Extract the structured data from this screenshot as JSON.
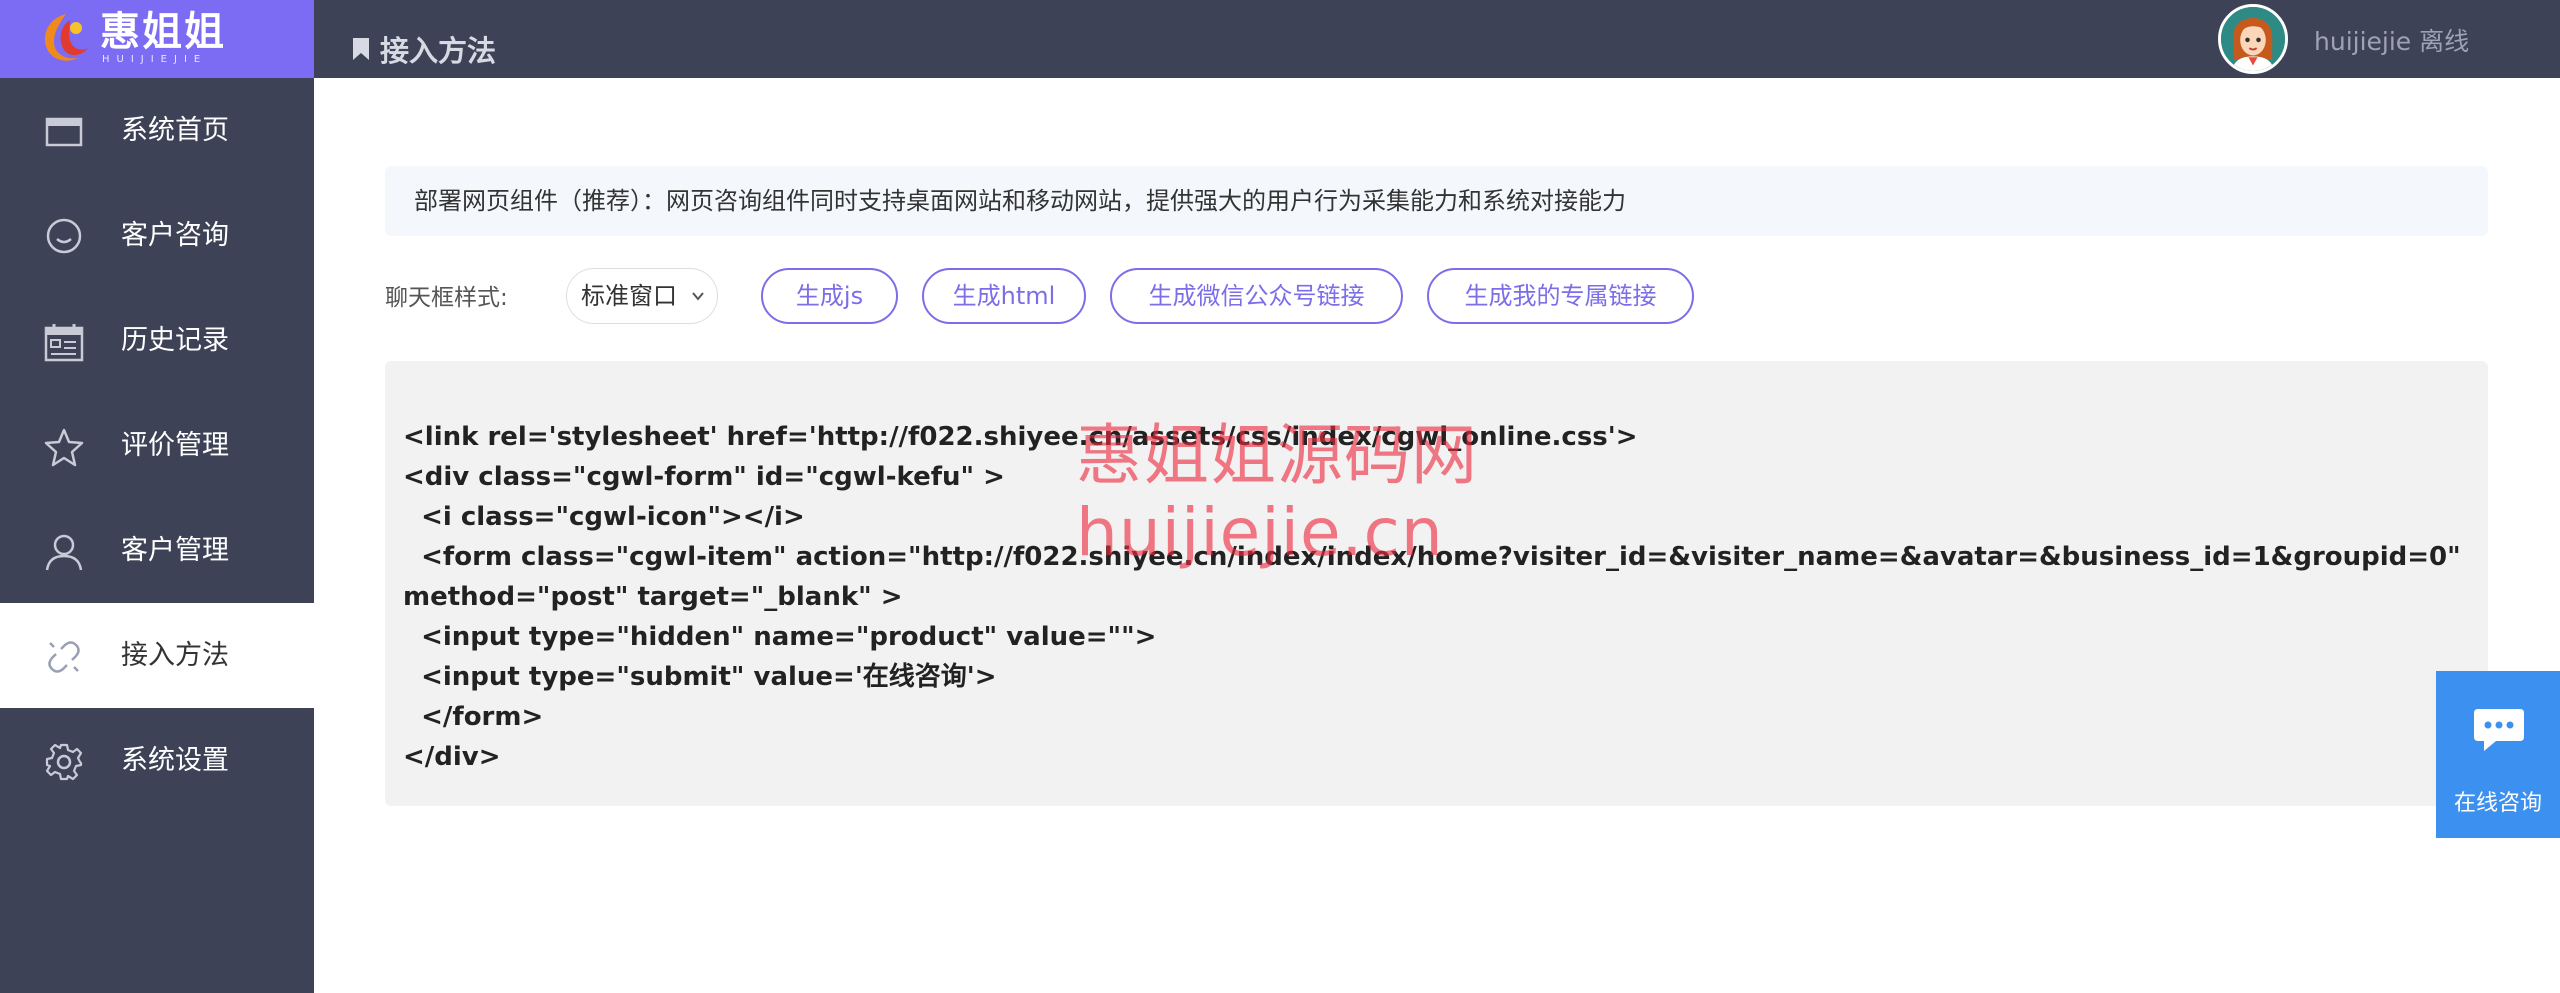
{
  "brand": {
    "name": "惠姐姐",
    "sub": "HUIJIEJIE"
  },
  "header": {
    "title": "接入方法",
    "user": "huijiejie 离线"
  },
  "sidebar": {
    "items": [
      {
        "label": "系统首页",
        "icon": "window-icon"
      },
      {
        "label": "客户咨询",
        "icon": "chat-bubble-icon"
      },
      {
        "label": "历史记录",
        "icon": "calendar-list-icon"
      },
      {
        "label": "评价管理",
        "icon": "star-icon"
      },
      {
        "label": "客户管理",
        "icon": "user-icon"
      },
      {
        "label": "接入方法",
        "icon": "link-icon",
        "active": true
      },
      {
        "label": "系统设置",
        "icon": "gear-icon"
      }
    ]
  },
  "main": {
    "notice": "部署网页组件（推荐）：网页咨询组件同时支持桌面网站和移动网站，提供强大的用户行为采集能力和系统对接能力",
    "style_label": "聊天框样式:",
    "style_select": "标准窗口",
    "buttons": [
      "生成js",
      "生成html",
      "生成微信公众号链接",
      "生成我的专属链接"
    ],
    "code_lines": [
      "<link rel='stylesheet' href='http://f022.shiyee.cn/assets/css/index/cgwl_online.css'>",
      "<div class=\"cgwl-form\" id=\"cgwl-kefu\" >",
      "  <i class=\"cgwl-icon\"></i>",
      "  <form class=\"cgwl-item\" action=\"http://f022.shiyee.cn/index/index/home?visiter_id=&visiter_name=&avatar=&business_id=1&groupid=0\"",
      "method=\"post\" target=\"_blank\" >",
      "  <input type=\"hidden\" name=\"product\" value=\"\">",
      "  <input type=\"submit\" value='在线咨询'>",
      "  </form>",
      "</div>"
    ]
  },
  "watermark": {
    "line1": "惠姐姐源码网",
    "line2": "huijiejie.cn"
  },
  "float_chat": {
    "label": "在线咨询"
  },
  "colors": {
    "sidebar": "#3e4257",
    "accent": "#7c6cf4",
    "float": "#3b90f0"
  }
}
